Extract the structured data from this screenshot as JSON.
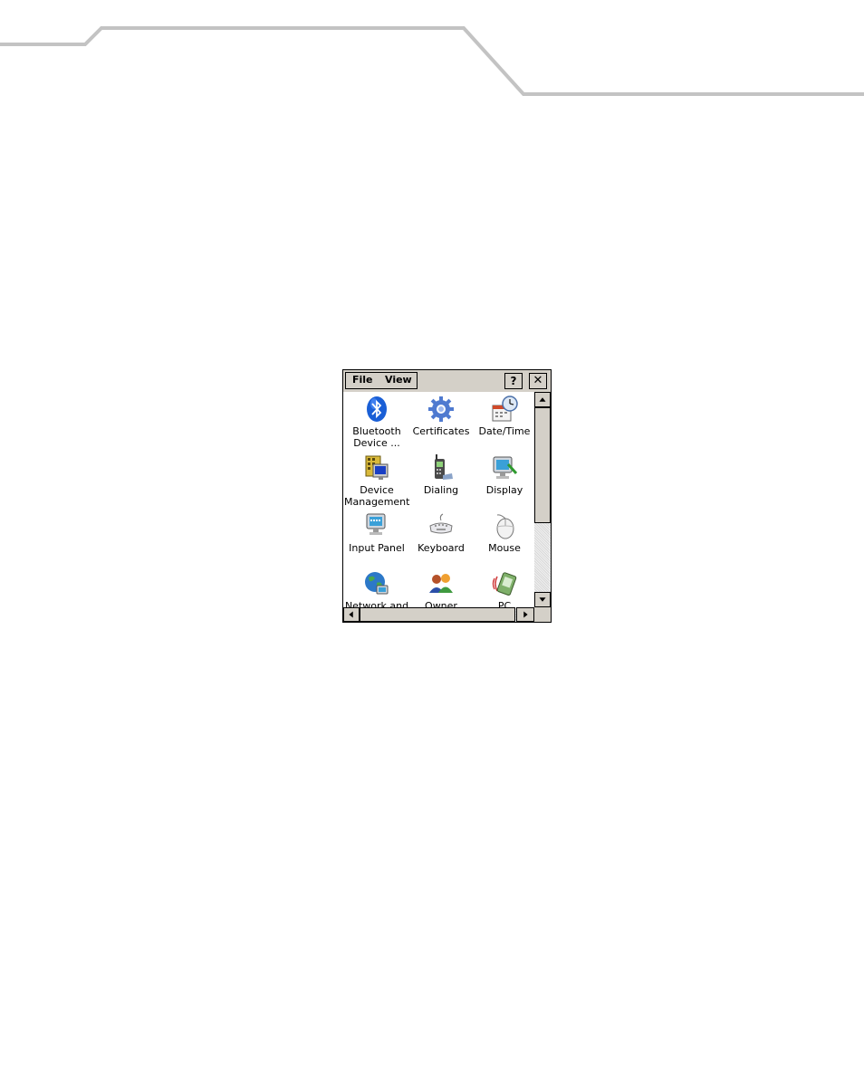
{
  "menu": {
    "file_label": "File",
    "view_label": "View",
    "help_label": "?",
    "close_label": "✕"
  },
  "icons": [
    {
      "label1": "Bluetooth",
      "label2": "Device ...",
      "icon": "bluetooth-icon"
    },
    {
      "label1": "Certificates",
      "label2": "",
      "icon": "certificates-icon"
    },
    {
      "label1": "Date/Time",
      "label2": "",
      "icon": "date-time-icon"
    },
    {
      "label1": "Device",
      "label2": "Management",
      "icon": "device-management-icon"
    },
    {
      "label1": "Dialing",
      "label2": "",
      "icon": "dialing-icon"
    },
    {
      "label1": "Display",
      "label2": "",
      "icon": "display-icon"
    },
    {
      "label1": "Input Panel",
      "label2": "",
      "icon": "input-panel-icon"
    },
    {
      "label1": "Keyboard",
      "label2": "",
      "icon": "keyboard-icon"
    },
    {
      "label1": "Mouse",
      "label2": "",
      "icon": "mouse-icon"
    },
    {
      "label1": "Network and",
      "label2": "",
      "icon": "network-icon"
    },
    {
      "label1": "Owner",
      "label2": "",
      "icon": "owner-icon"
    },
    {
      "label1": "PC",
      "label2": "",
      "icon": "pc-connection-icon"
    }
  ],
  "colors": {
    "chrome": "#d4d0c8",
    "header_rule": "#c0c0c0"
  }
}
